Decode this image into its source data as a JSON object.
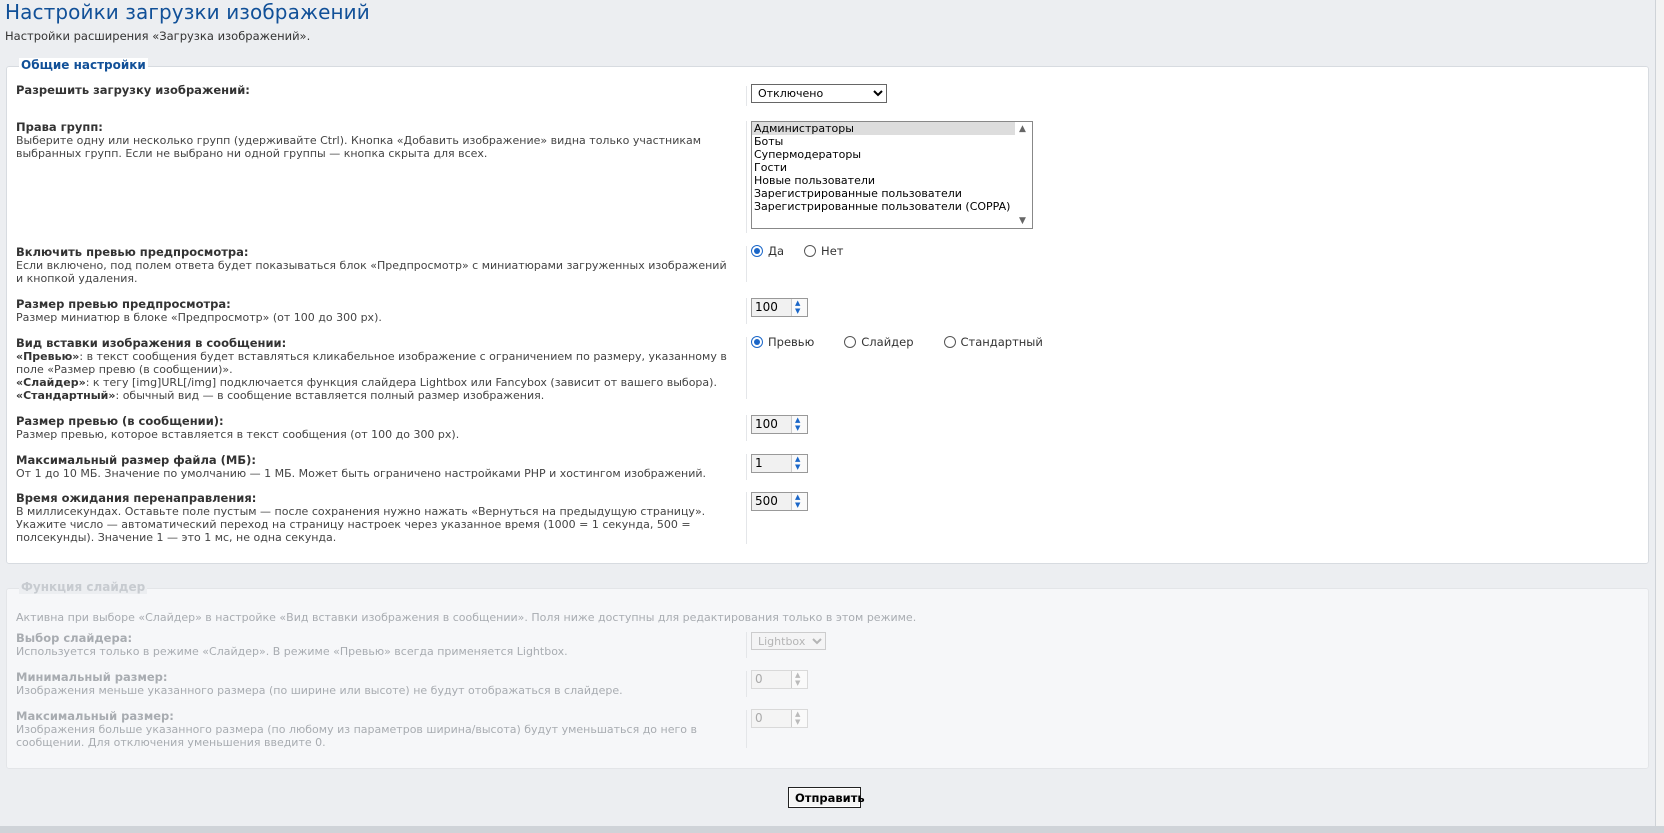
{
  "header": {
    "title": "Настройки загрузки изображений",
    "subtitle": "Настройки расширения «Загрузка изображений»."
  },
  "general": {
    "legend": "Общие настройки",
    "allow_upload": {
      "label": "Разрешить загрузку изображений:",
      "value": "Отключено"
    },
    "group_rights": {
      "label": "Права групп:",
      "desc": "Выберите одну или несколько групп (удерживайте Ctrl). Кнопка «Добавить изображение» видна только участникам выбранных групп. Если не выбрано ни одной группы — кнопка скрыта для всех.",
      "options": [
        "Администраторы",
        "Боты",
        "Супермодераторы",
        "Гости",
        "Новые пользователи",
        "Зарегистрированные пользователи",
        "Зарегистрированные пользователи (COPPA)"
      ],
      "selected_index": 0
    },
    "preview_enable": {
      "label": "Включить превью предпросмотра:",
      "desc": "Если включено, под полем ответа будет показываться блок «Предпросмотр» с миниатюрами загруженных изображений и кнопкой удаления.",
      "options": [
        "Да",
        "Нет"
      ],
      "selected": "Да"
    },
    "preview_size": {
      "label": "Размер превью предпросмотра:",
      "desc": "Размер миниатюр в блоке «Предпросмотр» (от 100 до 300 px).",
      "value": "100"
    },
    "insert_mode": {
      "label": "Вид вставки изображения в сообщении:",
      "line1_b": "«Превью»",
      "line1": ": в текст сообщения будет вставляться кликабельное изображение с ограничением по размеру, указанному в поле «Размер превю (в сообщении)».",
      "line2_b": "«Слайдер»",
      "line2": ": к тегу [img]URL[/img] подключается функция слайдера Lightbox или Fancybox (зависит от вашего выбора).",
      "line3_b": "«Стандартный»",
      "line3": ": обычный вид — в сообщение вставляется полный размер изображения.",
      "options": [
        "Превью",
        "Слайдер",
        "Стандартный"
      ],
      "selected": "Превью"
    },
    "msg_preview_size": {
      "label": "Размер превью (в сообщении):",
      "desc": "Размер превью, которое вставляется в текст сообщения (от 100 до 300 px).",
      "value": "100"
    },
    "max_file": {
      "label": "Максимальный размер файла (МБ):",
      "desc": "От 1 до 10 МБ. Значение по умолчанию — 1 МБ. Может быть ограничено настройками PHP и хостингом изображений.",
      "value": "1"
    },
    "redirect": {
      "label": "Время ожидания перенаправления:",
      "desc": "В миллисекундах. Оставьте поле пустым — после сохранения нужно нажать «Вернуться на предыдущую страницу». Укажите число — автоматический переход на страницу настроек через указанное время (1000 = 1 секунда, 500 = полсекунды). Значение 1 — это 1 мс, не одна секунда.",
      "value": "500"
    }
  },
  "slider": {
    "legend": "Функция слайдер",
    "note": "Активна при выборе «Слайдер» в настройке «Вид вставки изображения в сообщении». Поля ниже доступны для редактирования только в этом режиме.",
    "choice": {
      "label": "Выбор слайдера:",
      "desc": "Используется только в режиме «Слайдер». В режиме «Превью» всегда применяется Lightbox.",
      "value": "Lightbox"
    },
    "min_size": {
      "label": "Минимальный размер:",
      "desc": "Изображения меньше указанного размера (по ширине или высоте) не будут отображаться в слайдере.",
      "value": "0"
    },
    "max_size": {
      "label": "Максимальный размер:",
      "desc": "Изображения больше указанного размера (по любому из параметров ширина/высота) будут уменьшаться до него в сообщении. Для отключения уменьшения введите 0.",
      "value": "0"
    }
  },
  "submit_label": "Отправить"
}
